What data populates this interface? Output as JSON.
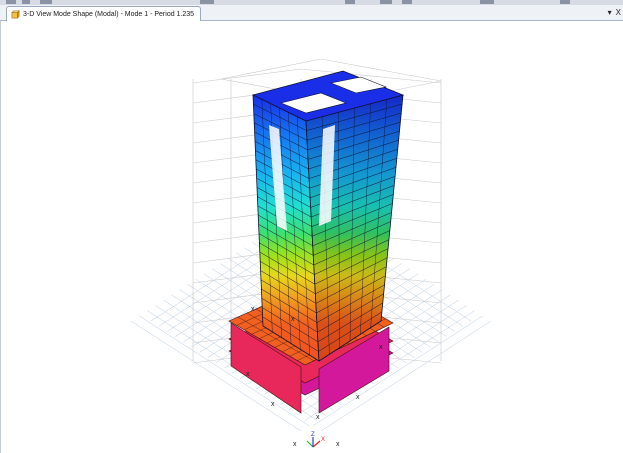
{
  "window": {
    "tab_title": "3-D View  Mode Shape (Modal) - Mode 1 - Period 1.235",
    "dropdown_glyph": "▾",
    "close_glyph": "X"
  },
  "model": {
    "axis_labels": {
      "x": "X",
      "y": "Y",
      "z": "Z"
    },
    "support_marker": "x",
    "contour_colors": [
      "#1a2ee8",
      "#1676f0",
      "#19b4f0",
      "#20e0d0",
      "#3de070",
      "#9be21c",
      "#e8d81c",
      "#f0a020",
      "#f06020",
      "#e8285a",
      "#d4189c"
    ],
    "grid_color": "#b9cde0"
  }
}
